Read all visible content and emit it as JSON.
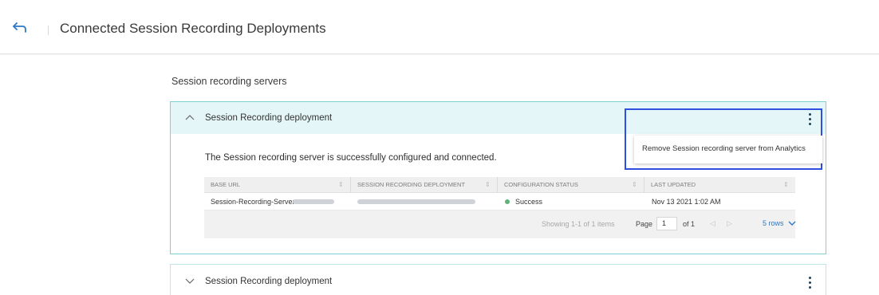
{
  "header": {
    "title": "Connected Session Recording Deployments",
    "back_icon": "back-arrow-icon"
  },
  "main": {
    "section_title": "Session recording servers",
    "deployments": [
      {
        "title": "Session Recording deployment",
        "expanded": true,
        "message": "The Session recording server is successfully configured and connected.",
        "table": {
          "columns": [
            "BASE URL",
            "SESSION RECORDING DEPLOYMENT",
            "CONFIGURATION STATUS",
            "LAST UPDATED"
          ],
          "rows": [
            {
              "base_url": "Session-Recording-Server-",
              "deployment": "",
              "status": "Success",
              "last_updated": "Nov 13 2021 1:02 AM"
            }
          ],
          "pagination": {
            "showing": "Showing 1-1 of 1 items",
            "page_label": "Page",
            "page_value": "1",
            "of_label": "of 1",
            "rows_per_page": "5 rows"
          }
        },
        "menu": {
          "items": [
            "Remove Session recording server from Analytics"
          ]
        }
      },
      {
        "title": "Session Recording deployment",
        "expanded": false
      }
    ]
  },
  "colors": {
    "panel_header_bg": "#e4f6f7",
    "panel_border": "#7fd0d3",
    "success": "#5fb37a",
    "highlight": "#2e4fe0",
    "link": "#2f78c4"
  }
}
